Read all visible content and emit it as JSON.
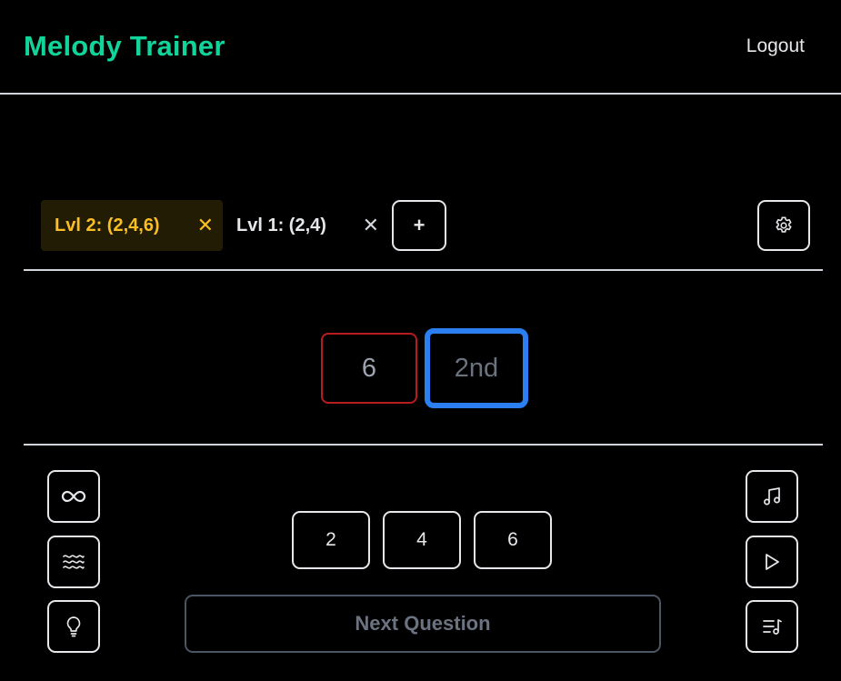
{
  "header": {
    "app_title": "Melody Trainer",
    "logout_label": "Logout"
  },
  "tabs": [
    {
      "label": "Lvl 2: (2,4,6)",
      "close": "✕",
      "active": true
    },
    {
      "label": "Lvl 1: (2,4)",
      "close": "✕",
      "active": false
    }
  ],
  "add_tab_label": "+",
  "answers": {
    "wrong": "6",
    "current": "2nd"
  },
  "choices": [
    "2",
    "4",
    "6"
  ],
  "next_question_label": "Next Question",
  "icons": {
    "settings": "gear-icon",
    "infinity": "infinity-icon",
    "waves": "waves-icon",
    "hint": "lightbulb-icon",
    "music": "music-note-icon",
    "play": "play-icon",
    "playlist": "playlist-music-icon"
  },
  "colors": {
    "brand": "#10d49a",
    "active_tab": "#fbbf24",
    "wrong": "#b91c1c",
    "current": "#2b7ff0"
  }
}
